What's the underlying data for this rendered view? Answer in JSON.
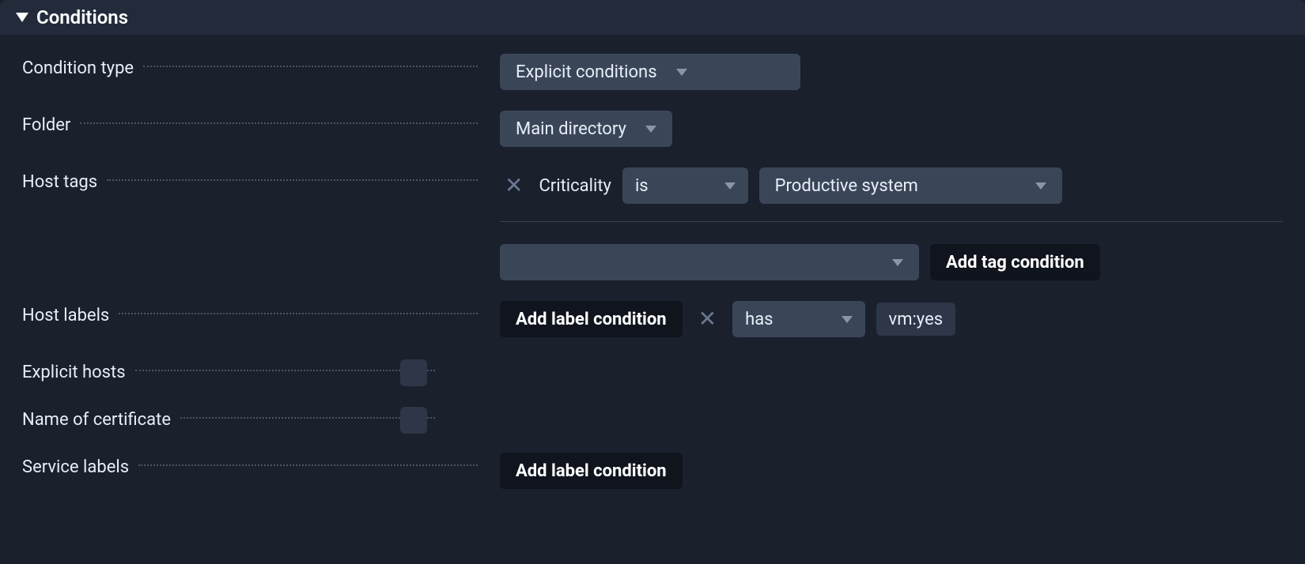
{
  "section": {
    "title": "Conditions"
  },
  "fields": {
    "condition_type": {
      "label": "Condition type",
      "value": "Explicit conditions"
    },
    "folder": {
      "label": "Folder",
      "value": "Main directory"
    },
    "host_tags": {
      "label": "Host tags",
      "tag_name": "Criticality",
      "operator": "is",
      "tag_value": "Productive system",
      "add_button": "Add tag condition"
    },
    "host_labels": {
      "label": "Host labels",
      "add_button": "Add label condition",
      "operator": "has",
      "value": "vm:yes"
    },
    "explicit_hosts": {
      "label": "Explicit hosts"
    },
    "name_of_certificate": {
      "label": "Name of certificate"
    },
    "service_labels": {
      "label": "Service labels",
      "add_button": "Add label condition"
    }
  }
}
